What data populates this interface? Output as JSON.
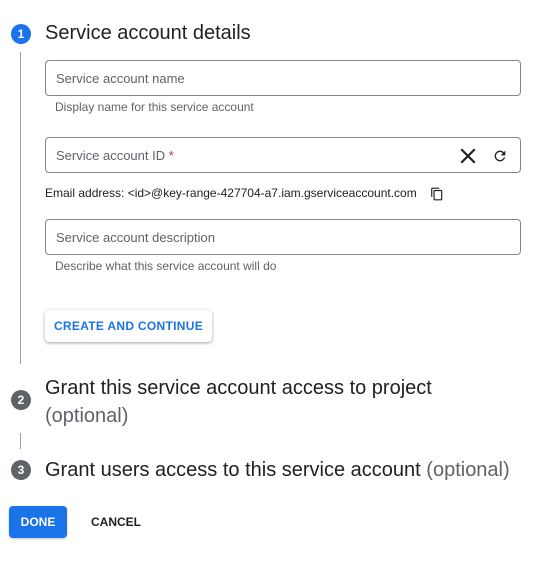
{
  "steps": [
    {
      "number": "1",
      "title": "Service account details",
      "state": "active"
    },
    {
      "number": "2",
      "title": "Grant this service account access to project",
      "optional": "(optional)",
      "state": "inactive"
    },
    {
      "number": "3",
      "title": "Grant users access to this service account",
      "optional": "(optional)",
      "state": "inactive"
    }
  ],
  "form": {
    "name_field": {
      "placeholder": "Service account name",
      "value": "",
      "hint": "Display name for this service account"
    },
    "id_field": {
      "label": "Service account ID",
      "required_mark": "*",
      "value": ""
    },
    "email_line": "Email address: <id>@key-range-427704-a7.iam.gserviceaccount.com",
    "description_field": {
      "placeholder": "Service account description",
      "value": "",
      "hint": "Describe what this service account will do"
    },
    "create_button_label": "CREATE AND CONTINUE"
  },
  "footer": {
    "done_label": "DONE",
    "cancel_label": "CANCEL"
  },
  "icons": {
    "clear": "close-icon",
    "refresh": "refresh-icon",
    "copy": "copy-icon"
  },
  "colors": {
    "accent": "#1a73e8",
    "inactive_step": "#5f6368",
    "required": "#d93025"
  }
}
